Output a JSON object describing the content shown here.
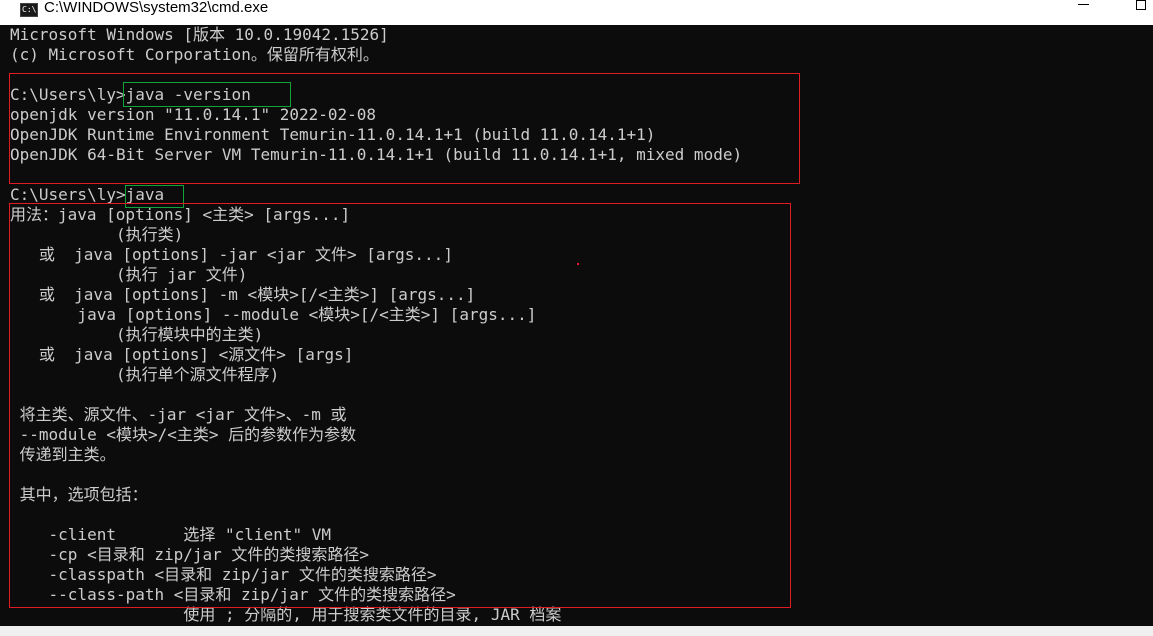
{
  "window": {
    "title": "C:\\WINDOWS\\system32\\cmd.exe",
    "icon_label": "C:\\",
    "controls": [
      "minimize-icon",
      "maximize-icon"
    ]
  },
  "console": {
    "lines": [
      "Microsoft Windows [版本 10.0.19042.1526]",
      "(c) Microsoft Corporation。保留所有权利。",
      "",
      "C:\\Users\\ly>java -version",
      "openjdk version \"11.0.14.1\" 2022-02-08",
      "OpenJDK Runtime Environment Temurin-11.0.14.1+1 (build 11.0.14.1+1)",
      "OpenJDK 64-Bit Server VM Temurin-11.0.14.1+1 (build 11.0.14.1+1, mixed mode)",
      "",
      "C:\\Users\\ly>java",
      "用法：java [options] <主类> [args...]",
      "           (执行类)",
      "   或  java [options] -jar <jar 文件> [args...]",
      "           (执行 jar 文件)",
      "   或  java [options] -m <模块>[/<主类>] [args...]",
      "       java [options] --module <模块>[/<主类>] [args...]",
      "           (执行模块中的主类)",
      "   或  java [options] <源文件> [args]",
      "           (执行单个源文件程序)",
      "",
      " 将主类、源文件、-jar <jar 文件>、-m 或",
      " --module <模块>/<主类> 后的参数作为参数",
      " 传递到主类。",
      "",
      " 其中，选项包括：",
      "",
      "    -client       选择 \"client\" VM",
      "    -cp <目录和 zip/jar 文件的类搜索路径>",
      "    -classpath <目录和 zip/jar 文件的类搜索路径>",
      "    --class-path <目录和 zip/jar 文件的类搜索路径>",
      "                  使用 ; 分隔的, 用于搜索类文件的目录, JAR 档案"
    ]
  },
  "colors": {
    "background": "#0c0c0c",
    "text": "#cccccc",
    "highlight_red": "#e01b24",
    "highlight_green": "#12a33a"
  }
}
